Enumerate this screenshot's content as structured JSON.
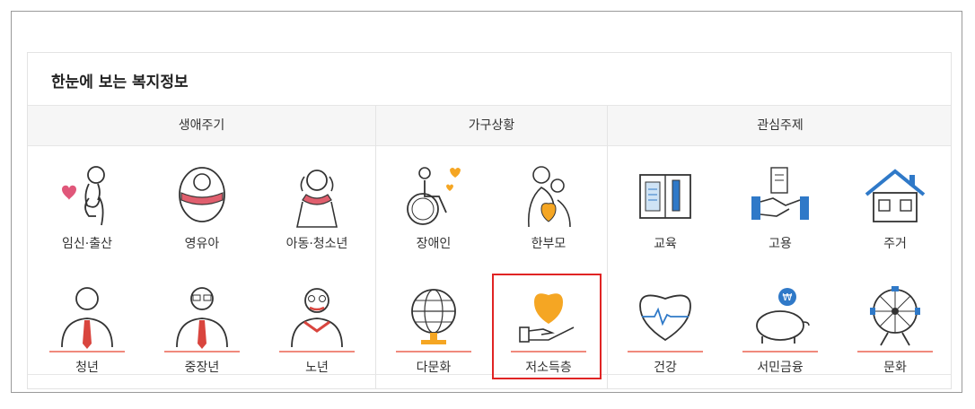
{
  "panel": {
    "title": "한눈에 보는 복지정보"
  },
  "groups": {
    "life": {
      "label": "생애주기"
    },
    "household": {
      "label": "가구상황"
    },
    "interest": {
      "label": "관심주제"
    }
  },
  "items": {
    "pregnancy": "임신·출산",
    "infant": "영유아",
    "child_youth": "아동·청소년",
    "young_adult": "청년",
    "middle_aged": "중장년",
    "elderly": "노년",
    "disabled": "장애인",
    "single_parent": "한부모",
    "multicultural": "다문화",
    "low_income": "저소득층",
    "education": "교육",
    "employment": "고용",
    "housing": "주거",
    "health": "건강",
    "finance": "서민금융",
    "culture": "문화"
  },
  "selected_item": "저소득층",
  "colors": {
    "accent": "#f08a7c",
    "selection": "#e02424",
    "orange": "#f5a623",
    "blue": "#2f79c8",
    "pink": "#e0577a"
  }
}
